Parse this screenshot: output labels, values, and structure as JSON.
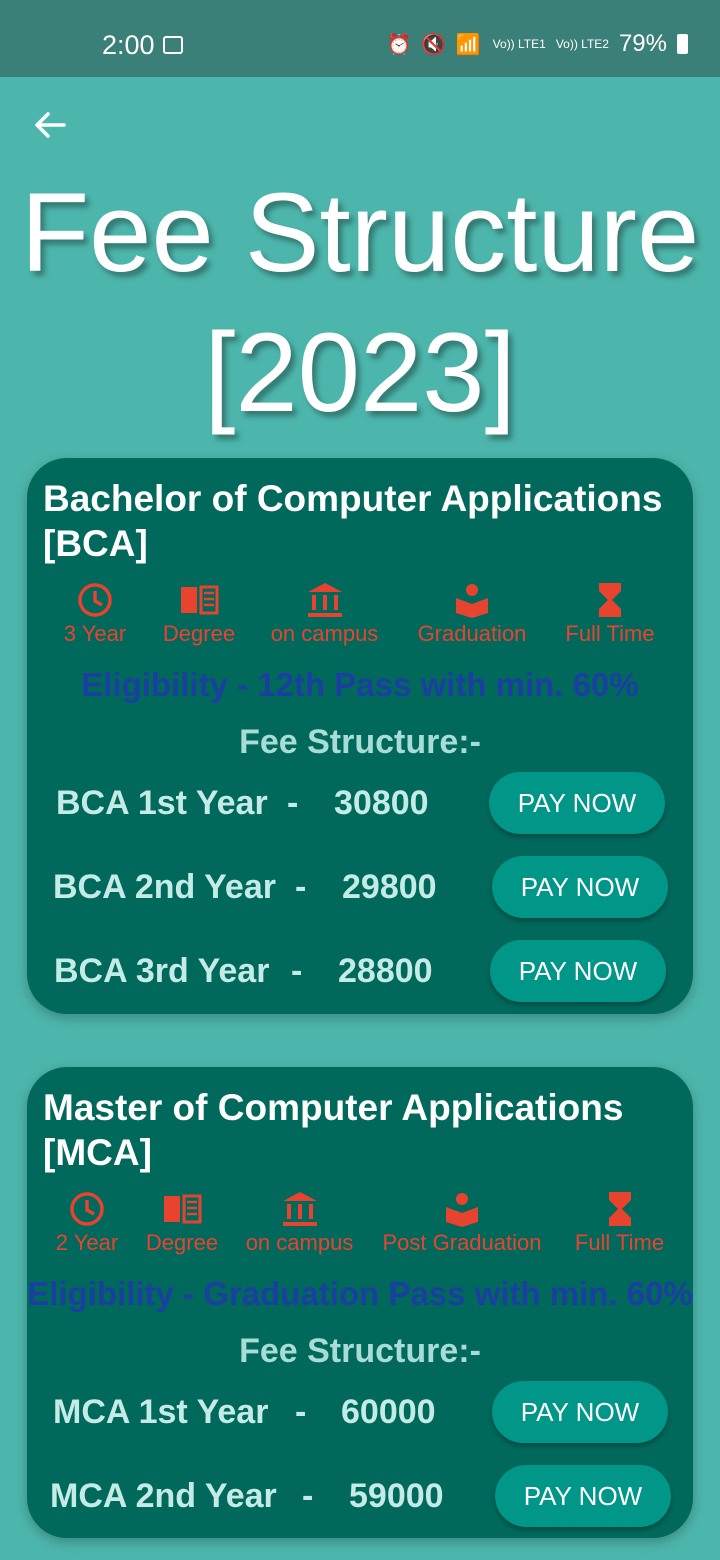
{
  "status": {
    "time": "2:00",
    "net1": "Vo)) LTE1",
    "net2": "Vo)) LTE2",
    "battery": "79%"
  },
  "title_line1": "Fee Structure",
  "title_line2": "[2023]",
  "bca": {
    "title": "Bachelor of Computer Applications [BCA]",
    "features": [
      "3 Year",
      "Degree",
      "on campus",
      "Graduation",
      "Full Time"
    ],
    "eligibility": "Eligibility - 12th Pass with min. 60%",
    "fee_heading": "Fee Structure:-",
    "rows": [
      {
        "year": "BCA 1st Year",
        "dash": "-",
        "amount": "30800",
        "button": "PAY NOW"
      },
      {
        "year": "BCA 2nd Year",
        "dash": "-",
        "amount": "29800",
        "button": "PAY NOW"
      },
      {
        "year": "BCA 3rd Year",
        "dash": "-",
        "amount": "28800",
        "button": "PAY NOW"
      }
    ]
  },
  "mca": {
    "title": "Master of Computer Applications [MCA]",
    "features": [
      "2 Year",
      "Degree",
      "on campus",
      "Post Graduation",
      "Full Time"
    ],
    "eligibility": "Eligibility - Graduation Pass with min. 60%",
    "fee_heading": "Fee Structure:-",
    "rows": [
      {
        "year": "MCA 1st Year",
        "dash": "-",
        "amount": "60000",
        "button": "PAY NOW"
      },
      {
        "year": "MCA 2nd Year",
        "dash": "-",
        "amount": "59000",
        "button": "PAY NOW"
      }
    ]
  },
  "icons": [
    "back-arrow-icon",
    "clock-icon",
    "book-icon",
    "bank-icon",
    "graduation-reader-icon",
    "hourglass-icon"
  ],
  "colors": {
    "background": "#4db6ac",
    "card": "#00695c",
    "accent_red": "#e8432e",
    "eligibility_blue": "#1a3fa0",
    "button": "#009688"
  }
}
